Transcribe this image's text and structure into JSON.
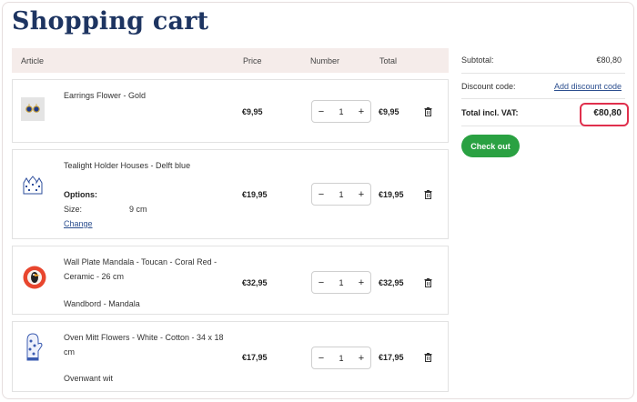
{
  "page": {
    "title": "Shopping cart"
  },
  "table_headers": {
    "article": "Article",
    "price": "Price",
    "number": "Number",
    "total": "Total"
  },
  "items": [
    {
      "name": "Earrings Flower - Gold",
      "price": "€9,95",
      "qty": "1",
      "total": "€9,95",
      "icon": "earrings-icon"
    },
    {
      "name": "Tealight Holder Houses - Delft blue",
      "options_title": "Options:",
      "option_label": "Size:",
      "option_value": "9 cm",
      "change_label": "Change",
      "price": "€19,95",
      "qty": "1",
      "total": "€19,95",
      "icon": "tealight-holder-icon"
    },
    {
      "name": "Wall Plate Mandala - Toucan - Coral Red - Ceramic - 26 cm",
      "subtext": "Wandbord - Mandala",
      "price": "€32,95",
      "qty": "1",
      "total": "€32,95",
      "icon": "wall-plate-icon"
    },
    {
      "name": "Oven Mitt Flowers - White - Cotton - 34 x 18 cm",
      "subtext": "Ovenwant wit",
      "price": "€17,95",
      "qty": "1",
      "total": "€17,95",
      "icon": "oven-mitt-icon"
    }
  ],
  "stepper": {
    "minus": "−",
    "plus": "+"
  },
  "summary": {
    "subtotal_label": "Subtotal:",
    "subtotal_value": "€80,80",
    "discount_label": "Discount code:",
    "discount_link": "Add discount code",
    "total_label": "Total incl. VAT:",
    "total_value": "€80,80",
    "checkout_label": "Check out"
  },
  "colors": {
    "heading": "#1d3461",
    "header_bg": "#f5ecea",
    "checkout": "#2aa142",
    "highlight": "#e0304d",
    "link": "#2c4f8f"
  }
}
